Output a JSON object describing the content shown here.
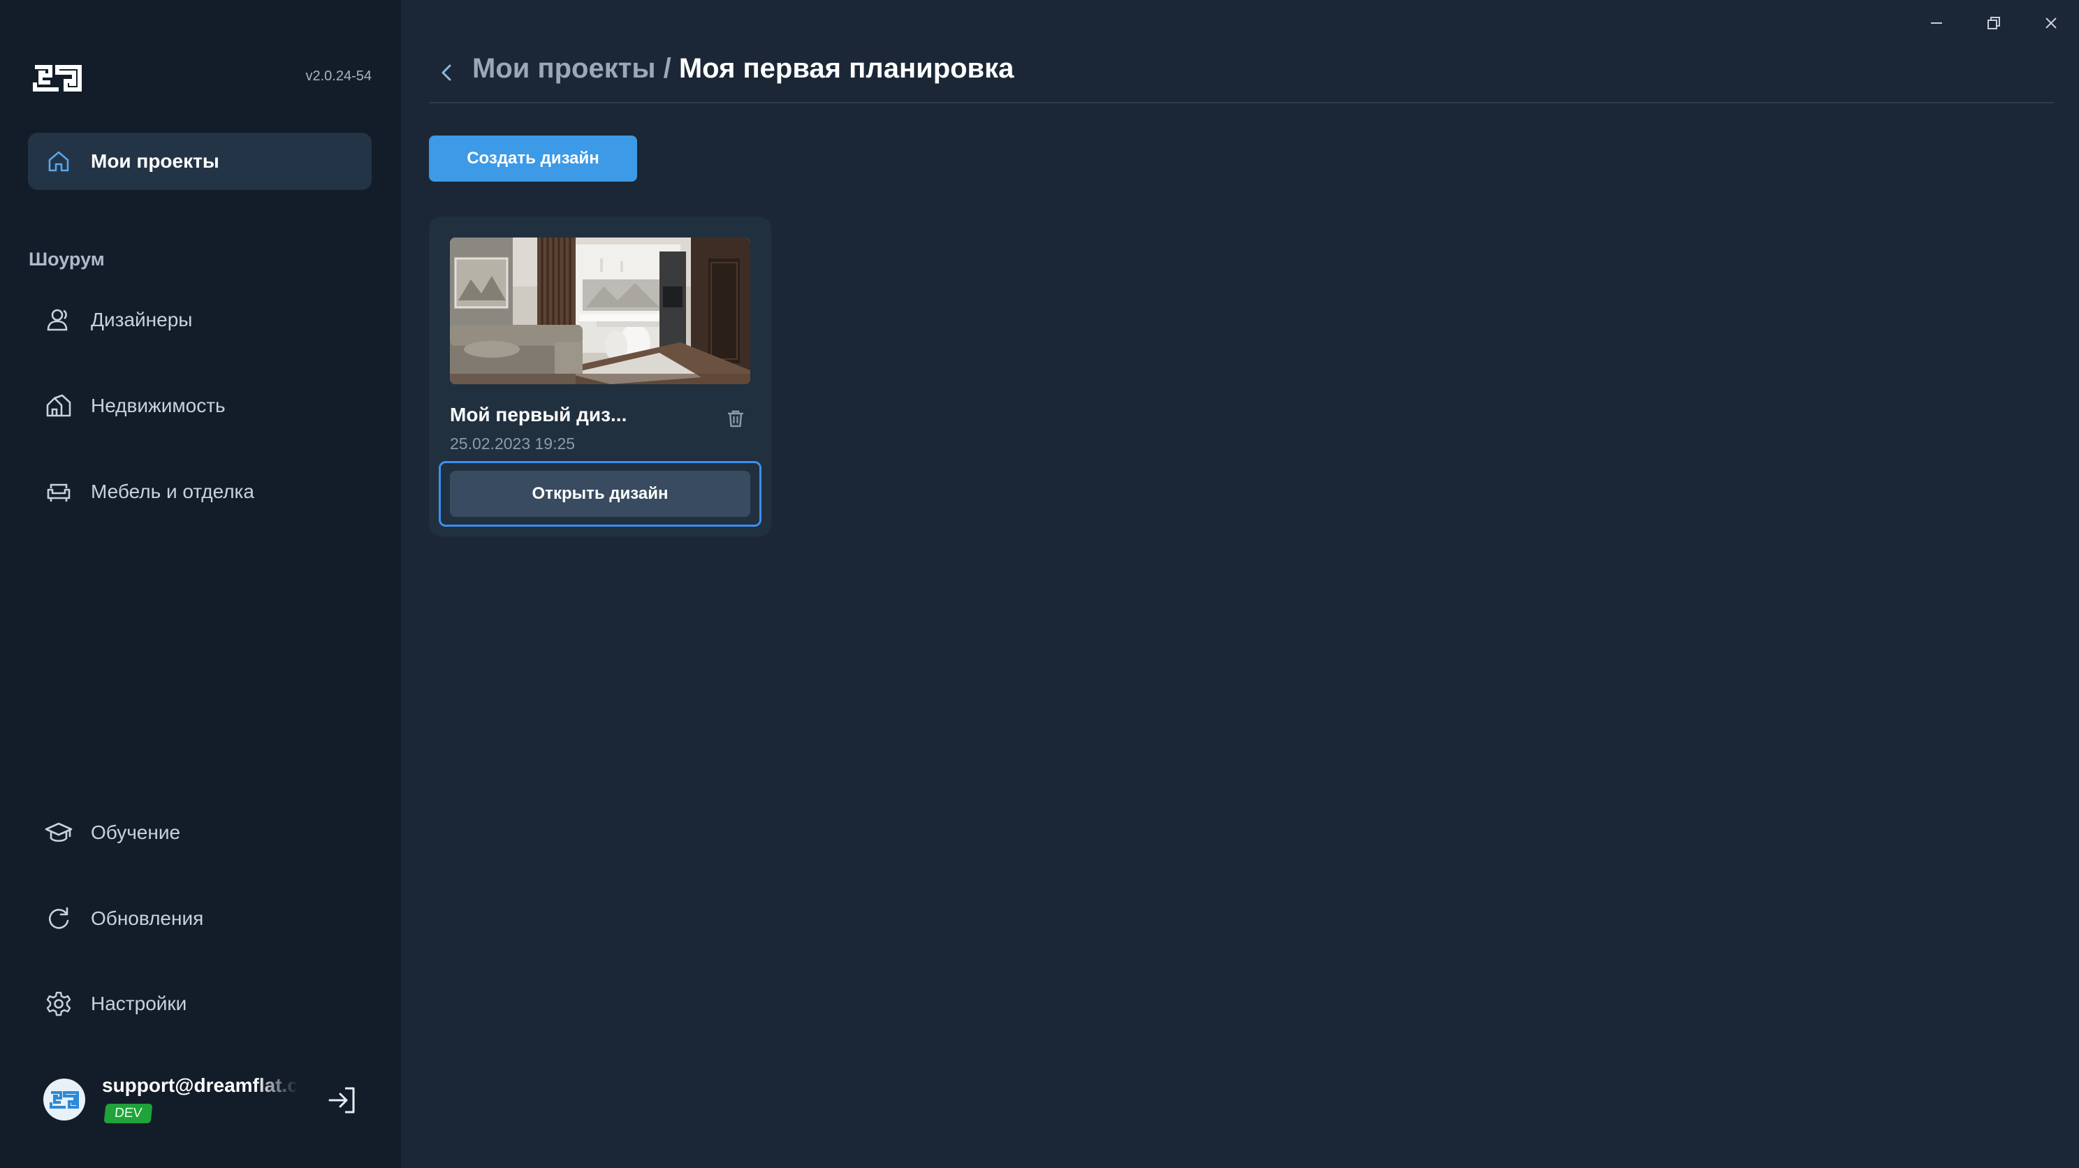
{
  "app": {
    "version": "v2.0.24-54"
  },
  "window_controls": {
    "minimize_icon": "minimize-icon",
    "restore_icon": "restore-icon",
    "close_icon": "close-icon"
  },
  "sidebar": {
    "main_item": {
      "label": "Мои проекты",
      "icon": "home-icon"
    },
    "section_title": "Шоурум",
    "showroom_items": [
      {
        "label": "Дизайнеры",
        "icon": "designers-icon"
      },
      {
        "label": "Недвижимость",
        "icon": "real-estate-icon"
      },
      {
        "label": "Мебель и отделка",
        "icon": "sofa-icon"
      }
    ],
    "bottom_items": [
      {
        "label": "Обучение",
        "icon": "graduation-cap-icon"
      },
      {
        "label": "Обновления",
        "icon": "refresh-icon"
      },
      {
        "label": "Настройки",
        "icon": "gear-icon"
      }
    ],
    "user": {
      "email": "support@dreamflat.co",
      "badge": "DEV"
    }
  },
  "header": {
    "breadcrumb_parent": "Мои проекты",
    "separator": " / ",
    "breadcrumb_current": "Моя первая планировка"
  },
  "main": {
    "create_button": "Создать дизайн",
    "card": {
      "title": "Мой первый диз...",
      "date": "25.02.2023 19:25",
      "open_button": "Открыть дизайн"
    }
  },
  "colors": {
    "sidebar_bg": "#131d29",
    "main_bg": "#1b2736",
    "accent": "#3d9ae6",
    "badge": "#1fa33a"
  }
}
